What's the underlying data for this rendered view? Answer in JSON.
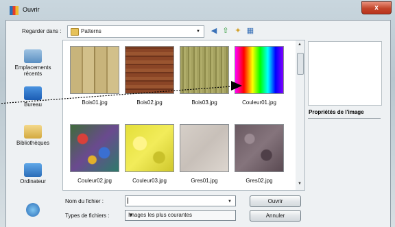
{
  "window": {
    "title": "Ouvrir",
    "close_label": "x"
  },
  "toolbar": {
    "look_in_label": "Regarder dans :",
    "look_in_value": "Patterns"
  },
  "places": [
    {
      "label": "Emplacements récents",
      "icon": "recent-places-icon"
    },
    {
      "label": "Bureau",
      "icon": "desktop-icon"
    },
    {
      "label": "Bibliothèques",
      "icon": "libraries-icon"
    },
    {
      "label": "Ordinateur",
      "icon": "computer-icon"
    },
    {
      "label": "",
      "icon": "network-icon"
    }
  ],
  "files": [
    {
      "name": "Bois01.jpg",
      "color": "#c9b47a"
    },
    {
      "name": "Bois02.jpg",
      "color": "#8a4526"
    },
    {
      "name": "Bois03.jpg",
      "color": "#9a9a55"
    },
    {
      "name": "Couleur01.jpg",
      "color": "#ff00ff"
    },
    {
      "name": "Couleur02.jpg",
      "color": "#3f6b3a"
    },
    {
      "name": "Couleur03.jpg",
      "color": "#e4df3a"
    },
    {
      "name": "Gres01.jpg",
      "color": "#d2cbc4"
    },
    {
      "name": "Gres02.jpg",
      "color": "#6a5a62"
    }
  ],
  "side": {
    "props_title": "Propriétés de l'image"
  },
  "form": {
    "filename_label": "Nom du fichier :",
    "filename_value": "",
    "filetype_label": "Types de fichiers :",
    "filetype_value": "Images les plus courantes",
    "open_button": "Ouvrir",
    "cancel_button": "Annuler"
  }
}
